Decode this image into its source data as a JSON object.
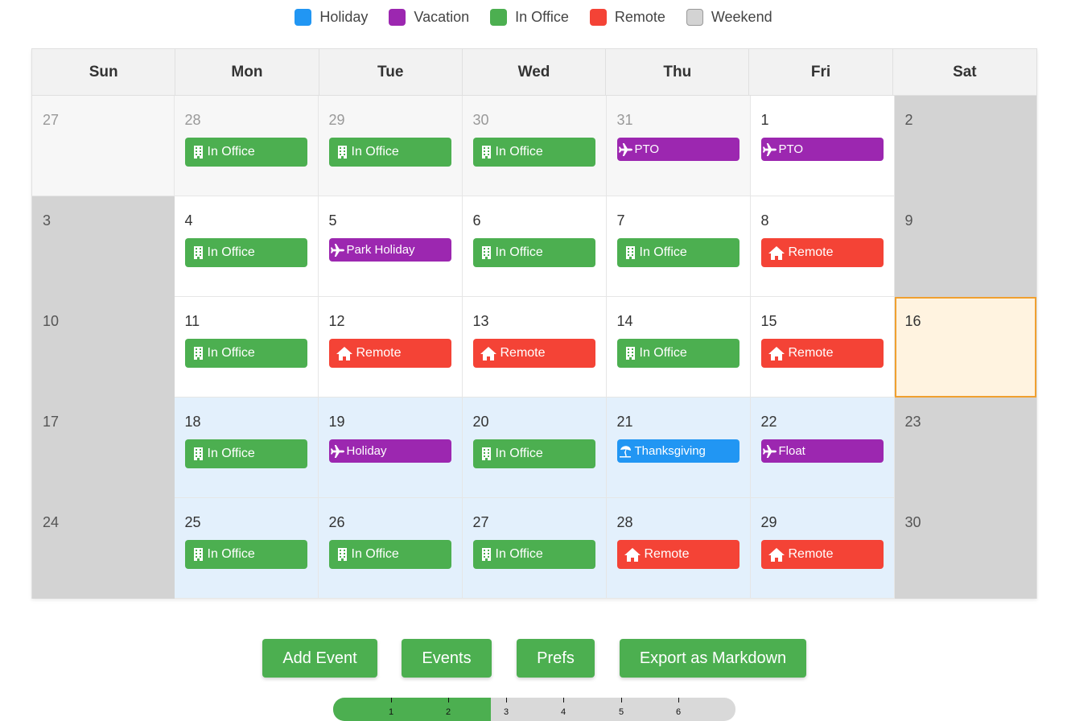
{
  "colors": {
    "holiday": "#2196f3",
    "vacation": "#9c27b0",
    "in_office": "#4caf50",
    "remote": "#f44336",
    "weekend": "#d3d3d3",
    "button": "#4caf50",
    "today_border": "#f0a030"
  },
  "legend": [
    {
      "label": "Holiday",
      "color": "#2196f3"
    },
    {
      "label": "Vacation",
      "color": "#9c27b0"
    },
    {
      "label": "In Office",
      "color": "#4caf50"
    },
    {
      "label": "Remote",
      "color": "#f44336"
    },
    {
      "label": "Weekend",
      "color": "#d3d3d3"
    }
  ],
  "weekdays": [
    "Sun",
    "Mon",
    "Tue",
    "Wed",
    "Thu",
    "Fri",
    "Sat"
  ],
  "days": [
    {
      "n": "27",
      "s": "other"
    },
    {
      "n": "28",
      "s": "other",
      "e": {
        "t": "office",
        "l": "In Office"
      }
    },
    {
      "n": "29",
      "s": "other",
      "e": {
        "t": "office",
        "l": "In Office"
      }
    },
    {
      "n": "30",
      "s": "other",
      "e": {
        "t": "office",
        "l": "In Office"
      }
    },
    {
      "n": "31",
      "s": "other",
      "e": {
        "t": "vacation",
        "l": "PTO"
      }
    },
    {
      "n": "1",
      "s": "",
      "e": {
        "t": "vacation",
        "l": "PTO"
      }
    },
    {
      "n": "2",
      "s": "weekend"
    },
    {
      "n": "3",
      "s": "weekend"
    },
    {
      "n": "4",
      "s": "",
      "e": {
        "t": "office",
        "l": "In Office"
      }
    },
    {
      "n": "5",
      "s": "",
      "e": {
        "t": "vacation",
        "l": "Park Holiday"
      }
    },
    {
      "n": "6",
      "s": "",
      "e": {
        "t": "office",
        "l": "In Office"
      }
    },
    {
      "n": "7",
      "s": "",
      "e": {
        "t": "office",
        "l": "In Office"
      }
    },
    {
      "n": "8",
      "s": "",
      "e": {
        "t": "remote",
        "l": "Remote"
      }
    },
    {
      "n": "9",
      "s": "weekend"
    },
    {
      "n": "10",
      "s": "weekend"
    },
    {
      "n": "11",
      "s": "",
      "e": {
        "t": "office",
        "l": "In Office"
      }
    },
    {
      "n": "12",
      "s": "",
      "e": {
        "t": "remote",
        "l": "Remote"
      }
    },
    {
      "n": "13",
      "s": "",
      "e": {
        "t": "remote",
        "l": "Remote"
      }
    },
    {
      "n": "14",
      "s": "",
      "e": {
        "t": "office",
        "l": "In Office"
      }
    },
    {
      "n": "15",
      "s": "",
      "e": {
        "t": "remote",
        "l": "Remote"
      }
    },
    {
      "n": "16",
      "s": "today"
    },
    {
      "n": "17",
      "s": "weekend"
    },
    {
      "n": "18",
      "s": "week-hl",
      "e": {
        "t": "office",
        "l": "In Office"
      }
    },
    {
      "n": "19",
      "s": "week-hl",
      "e": {
        "t": "vacation",
        "l": "Holiday"
      }
    },
    {
      "n": "20",
      "s": "week-hl",
      "e": {
        "t": "office",
        "l": "In Office"
      }
    },
    {
      "n": "21",
      "s": "week-hl",
      "e": {
        "t": "holiday",
        "l": "Thanksgiving"
      }
    },
    {
      "n": "22",
      "s": "week-hl",
      "e": {
        "t": "vacation",
        "l": "Float"
      }
    },
    {
      "n": "23",
      "s": "weekend"
    },
    {
      "n": "24",
      "s": "weekend"
    },
    {
      "n": "25",
      "s": "week-hl",
      "e": {
        "t": "office",
        "l": "In Office"
      }
    },
    {
      "n": "26",
      "s": "week-hl",
      "e": {
        "t": "office",
        "l": "In Office"
      }
    },
    {
      "n": "27",
      "s": "week-hl",
      "e": {
        "t": "office",
        "l": "In Office"
      }
    },
    {
      "n": "28",
      "s": "week-hl",
      "e": {
        "t": "remote",
        "l": "Remote"
      }
    },
    {
      "n": "29",
      "s": "week-hl",
      "e": {
        "t": "remote",
        "l": "Remote"
      }
    },
    {
      "n": "30",
      "s": "weekend"
    }
  ],
  "buttons": {
    "add_event": "Add Event",
    "events": "Events",
    "prefs": "Prefs",
    "export": "Export as Markdown"
  },
  "slider": {
    "value": 2.5,
    "ticks": [
      "1",
      "2",
      "3",
      "4",
      "5",
      "6"
    ]
  },
  "icons": {
    "office": "building-icon",
    "remote": "house-icon",
    "vacation": "plane-icon",
    "holiday": "beach-umbrella-icon"
  }
}
